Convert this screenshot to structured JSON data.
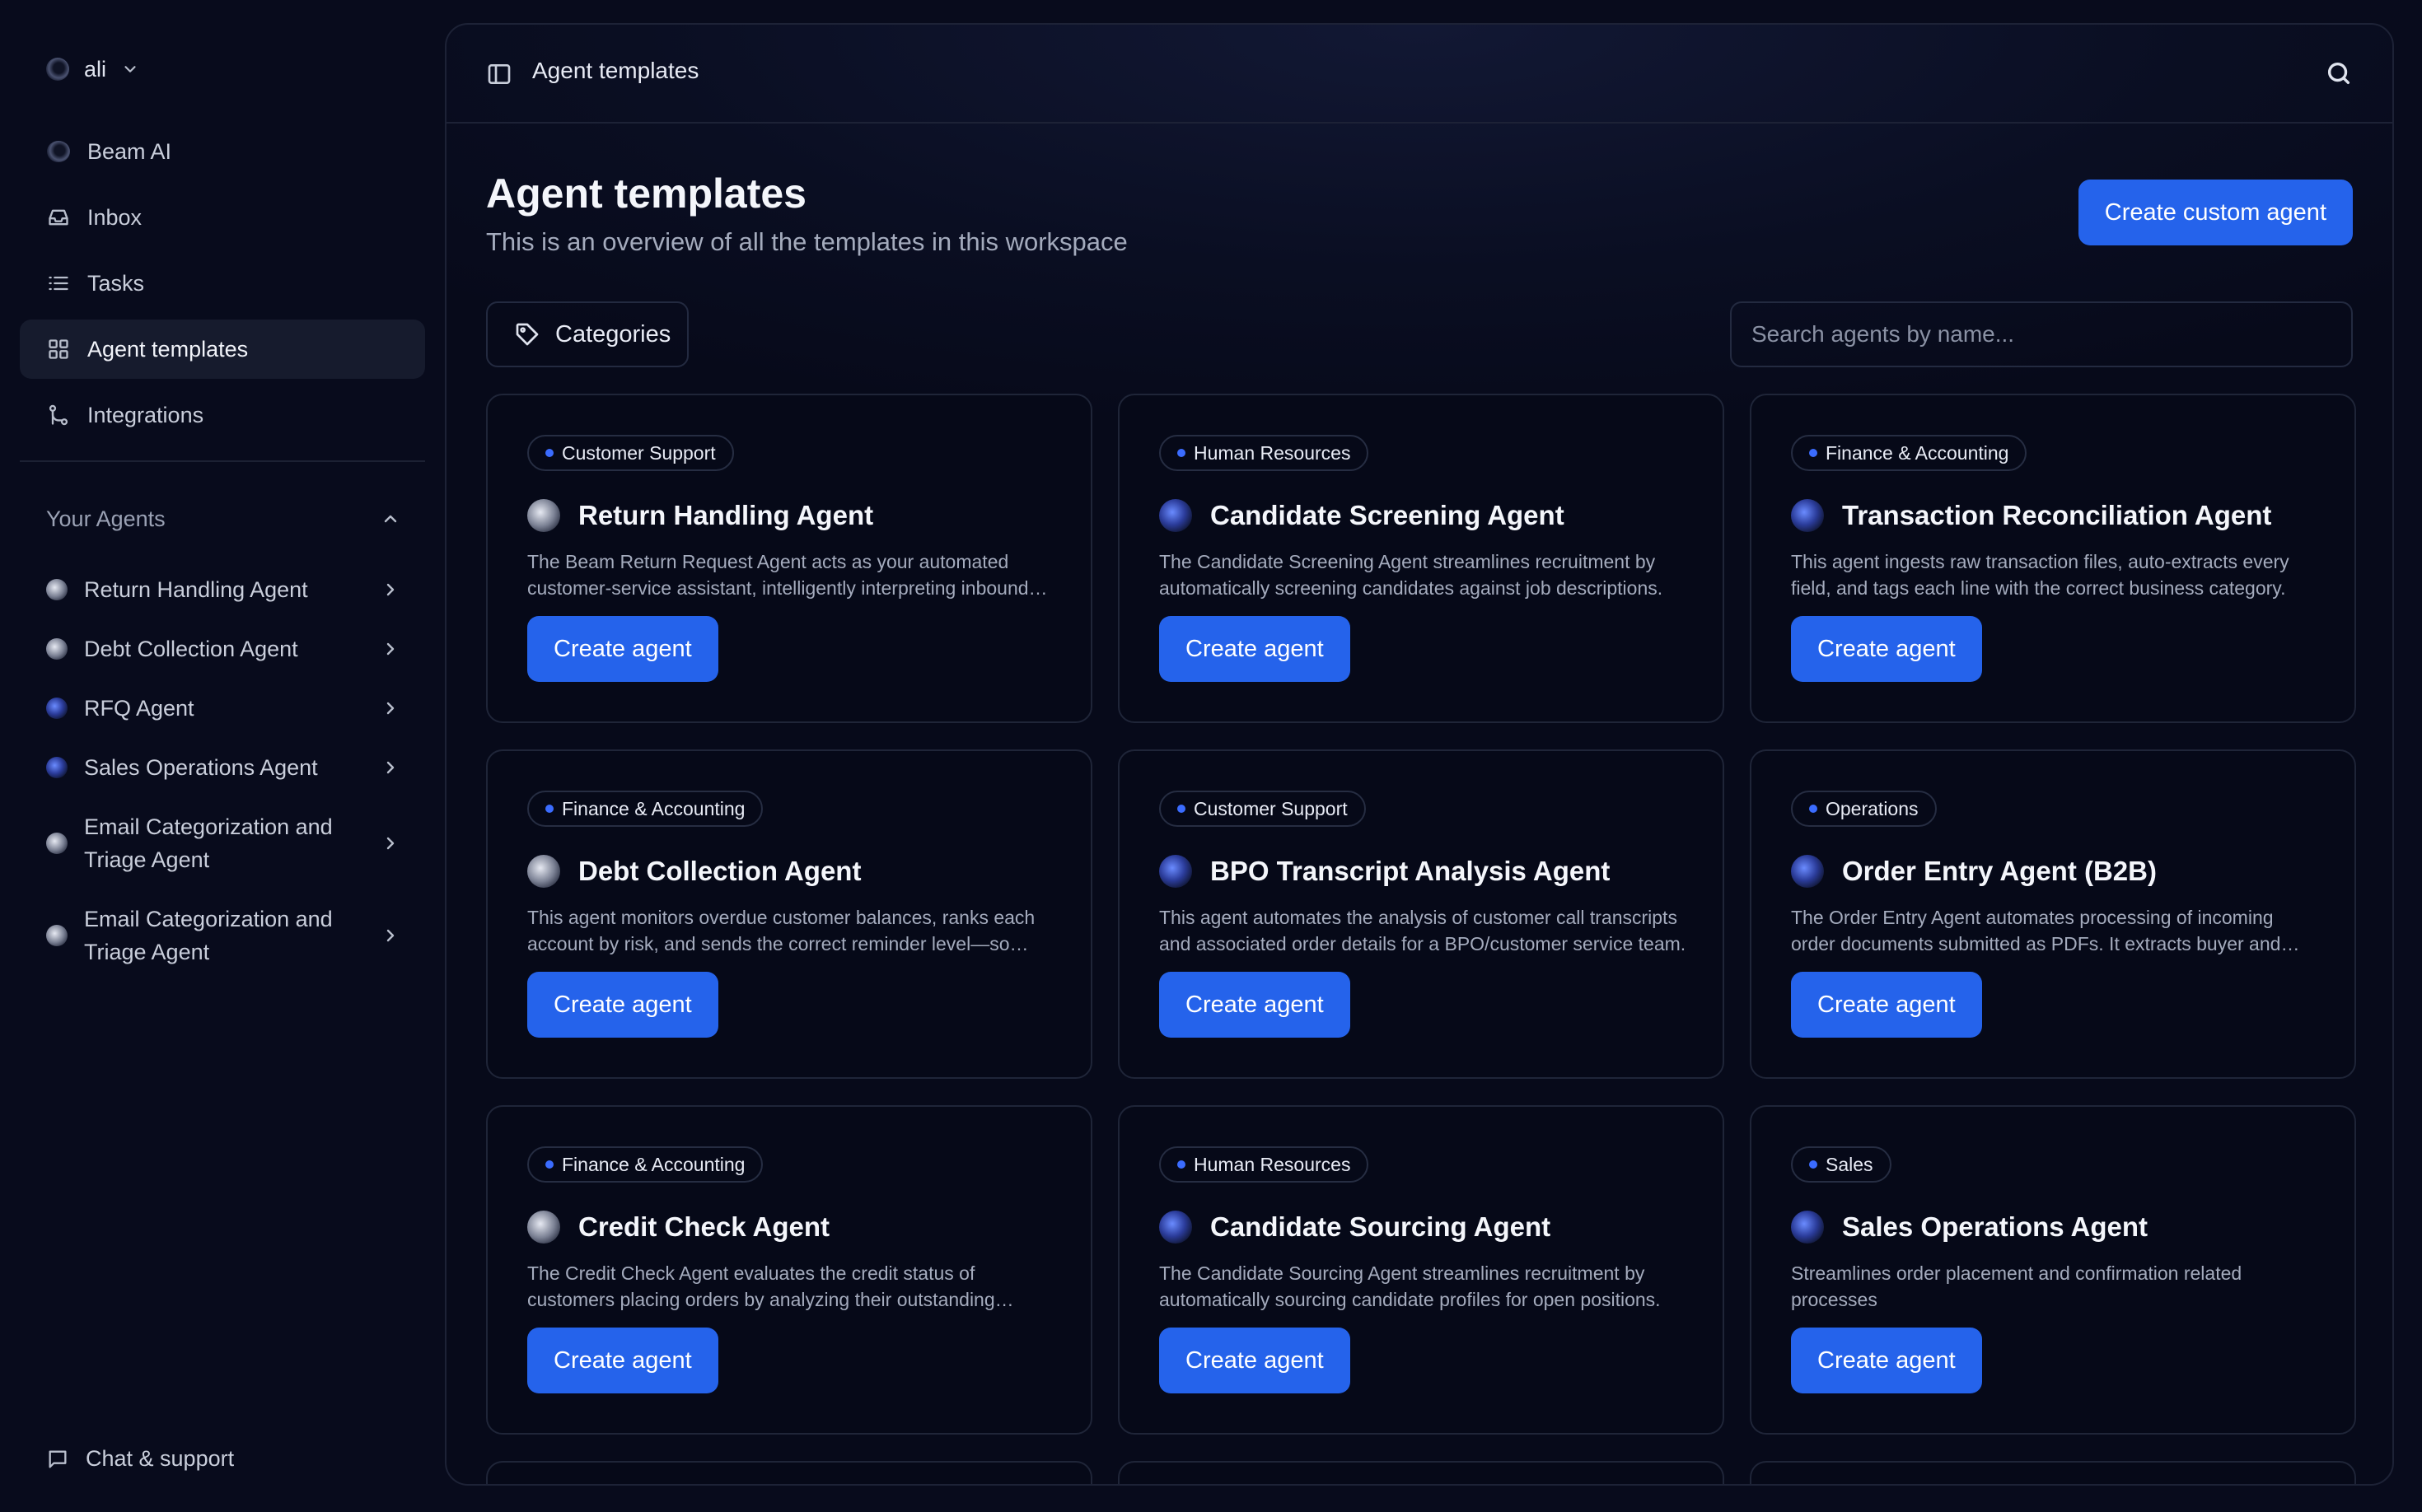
{
  "workspace": {
    "name": "ali"
  },
  "nav": [
    {
      "id": "beam-ai",
      "label": "Beam AI",
      "icon": "beam-orb-icon"
    },
    {
      "id": "inbox",
      "label": "Inbox",
      "icon": "inbox-icon"
    },
    {
      "id": "tasks",
      "label": "Tasks",
      "icon": "list-icon"
    },
    {
      "id": "agent-templates",
      "label": "Agent templates",
      "icon": "grid-icon",
      "active": true
    },
    {
      "id": "integrations",
      "label": "Integrations",
      "icon": "git-merge-icon"
    }
  ],
  "your_agents": {
    "heading": "Your Agents",
    "items": [
      {
        "label": "Return Handling Agent"
      },
      {
        "label": "Debt Collection Agent"
      },
      {
        "label": "RFQ Agent"
      },
      {
        "label": "Sales Operations Agent"
      },
      {
        "label": "Email Categorization and Triage Agent"
      },
      {
        "label": "Email Categorization and Triage Agent"
      }
    ]
  },
  "footer": {
    "chat_label": "Chat & support"
  },
  "topbar": {
    "breadcrumb": "Agent templates"
  },
  "header": {
    "title": "Agent templates",
    "subtitle": "This is an overview of all the templates in this workspace",
    "create_custom_label": "Create custom agent"
  },
  "filters": {
    "categories_label": "Categories",
    "search_placeholder": "Search agents by name..."
  },
  "colors": {
    "accent": "#2563eb",
    "badge_dot": "#3b6cff",
    "background": "#080b1c"
  },
  "cards": [
    {
      "category": "Customer Support",
      "title": "Return Handling Agent",
      "description": "The Beam Return Request Agent acts as your automated customer-service assistant, intelligently interpreting inbound requests.",
      "button": "Create agent"
    },
    {
      "category": "Human Resources",
      "title": "Candidate Screening Agent",
      "description": "The Candidate Screening Agent streamlines recruitment by automatically screening candidates against job descriptions.",
      "button": "Create agent"
    },
    {
      "category": "Finance & Accounting",
      "title": "Transaction Reconciliation Agent",
      "description": "This agent ingests raw transaction files, auto-extracts every field, and tags each line with the correct business category.",
      "button": "Create agent"
    },
    {
      "category": "Finance & Accounting",
      "title": "Debt Collection Agent",
      "description": "This agent monitors overdue customer balances, ranks each account by risk, and sends the correct reminder level—so nothing slips.",
      "button": "Create agent"
    },
    {
      "category": "Customer Support",
      "title": "BPO Transcript Analysis Agent",
      "description": "This agent automates the analysis of customer call transcripts and associated order details for a BPO/customer service team.",
      "button": "Create agent"
    },
    {
      "category": "Operations",
      "title": "Order Entry Agent (B2B)",
      "description": "The Order Entry Agent automates processing of incoming order documents submitted as PDFs. It extracts buyer and order data.",
      "button": "Create agent"
    },
    {
      "category": "Finance & Accounting",
      "title": "Credit Check Agent",
      "description": "The Credit Check Agent evaluates the credit status of customers placing orders by analyzing their outstanding balances.",
      "button": "Create agent"
    },
    {
      "category": "Human Resources",
      "title": "Candidate Sourcing Agent",
      "description": "The Candidate Sourcing Agent streamlines recruitment by automatically sourcing candidate profiles for open positions.",
      "button": "Create agent"
    },
    {
      "category": "Sales",
      "title": "Sales Operations Agent",
      "description": "Streamlines order placement and confirmation related processes",
      "button": "Create agent"
    }
  ]
}
